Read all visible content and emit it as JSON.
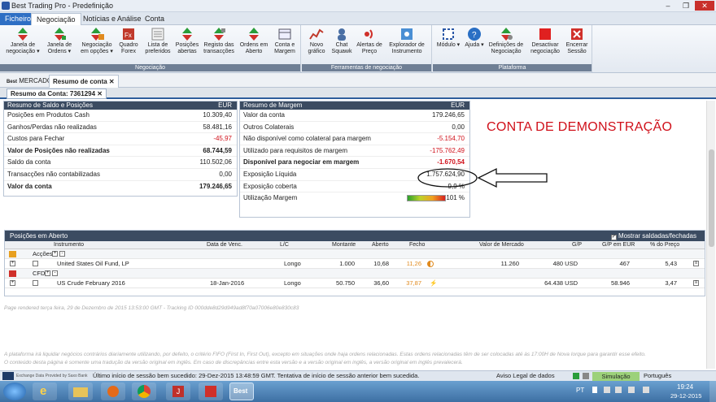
{
  "window": {
    "title": "Best Trading Pro - Predefinição",
    "minimize": "–",
    "restore": "❐",
    "close": "✕"
  },
  "menu": {
    "file": "Ficheiro",
    "tabs": [
      "Negociação",
      "Notícias e Análise",
      "Conta"
    ]
  },
  "ribbon": {
    "groups": [
      {
        "label": "Negociação",
        "buttons": [
          "Janela de negociação ▾",
          "Janela de Ordens ▾",
          "Negociação em opções ▾",
          "Quadro Forex",
          "Lista de preferidos",
          "Posições abertas",
          "Registo das transacções",
          "Ordens em Aberto",
          "Conta e Margem"
        ]
      },
      {
        "label": "Ferramentas de negociação",
        "buttons": [
          "Novo gráfico",
          "Chat Squawk",
          "Alertas de Preço",
          "Explorador de Instrumento"
        ]
      },
      {
        "label": "Plataforma",
        "buttons": [
          "Módulo ▾",
          "Ajuda ▾",
          "Definições de Negociação",
          "Desactivar negociação",
          "Encerrar Sessão"
        ]
      }
    ]
  },
  "doctabs": {
    "markets": "MERCADOS",
    "account_summary": "Resumo de conta",
    "close": "✕"
  },
  "subtab": {
    "label": "Resumo da Conta: 7361294",
    "close": "✕"
  },
  "balance": {
    "title": "Resumo de Saldo e Posições",
    "currency": "EUR",
    "rows": [
      {
        "label": "Posições em Produtos Cash",
        "value": "10.309,40"
      },
      {
        "label": "Ganhos/Perdas não realizadas",
        "value": "58.481,16"
      },
      {
        "label": "Custos para Fechar",
        "value": "-45,97"
      },
      {
        "label": "Valor de Posições não realizadas",
        "value": "68.744,59"
      },
      {
        "label": "Saldo da conta",
        "value": "110.502,06"
      },
      {
        "label": "Transacções não contabilizadas",
        "value": "0,00"
      },
      {
        "label": "Valor da conta",
        "value": "179.246,65"
      }
    ]
  },
  "margin": {
    "title": "Resumo de Margem",
    "currency": "EUR",
    "rows": [
      {
        "label": "Valor da conta",
        "value": "179.246,65"
      },
      {
        "label": "Outros Colaterais",
        "value": "0,00"
      },
      {
        "label": "Não disponível como colateral para margem",
        "value": "-5.154,70"
      },
      {
        "label": "Utilizado para requisitos de margem",
        "value": "-175.762,49"
      },
      {
        "label": "Disponível para negociar em margem",
        "value": "-1.670,54"
      },
      {
        "label": "Exposição Líquida",
        "value": "1.757.624,90"
      },
      {
        "label": "Exposição coberta",
        "value": "9,9 %"
      },
      {
        "label": "Utilização Margem",
        "value": "101 %"
      }
    ],
    "utilization": 1.01
  },
  "demo_label": "CONTA DE DEMONSTRAÇÃO",
  "positions": {
    "title": "Posições em Aberto",
    "show_closed": "Mostrar saldadas/fechadas",
    "columns": [
      "Instrumento",
      "Data de Venc.",
      "L/C",
      "Montante",
      "Aberto",
      "Fecho",
      "Valor de Mercado",
      "G/P",
      "G/P em EUR",
      "% do Preço"
    ],
    "groups": [
      {
        "name": "Acções",
        "rows": [
          {
            "instrument": "United States Oil Fund, LP",
            "expiry": "",
            "side": "Longo",
            "amount": "1.000",
            "open": "10,68",
            "close": "11,26",
            "market_value": "11.260",
            "pl": "480 USD",
            "pl_eur": "467",
            "pct": "5,43"
          }
        ]
      },
      {
        "name": "CFD",
        "rows": [
          {
            "instrument": "US Crude February 2016",
            "expiry": "18-Jan-2016",
            "side": "Longo",
            "amount": "50.750",
            "open": "36,60",
            "close": "37,87",
            "market_value": "",
            "pl": "64.438 USD",
            "pl_eur": "58.946",
            "pct": "3,47"
          }
        ]
      }
    ]
  },
  "footer": {
    "rendered": "Page rendered terça feira, 29 de Dezembro de 2015 13:53:00 GMT - Tracking ID 000dde8d29d949ad8f70a07006e80e830c83",
    "disclaimer1": "A plataforma irá liquidar negócios contrários diariamente utilizando, por defeito, o critério FIFO (First In, First Out), excepto em situações onde haja ordens relacionadas. Estas ordens relacionadas têm de ser colocadas até às 17:00H de Nova Iorque para garantir esse efeito.",
    "disclaimer2": "O conteúdo desta página é somente uma tradução da versão original em inglês. Em caso de discrepâncias entre esta versão e a versão original em inglês, a versão original em inglês prevalecerá."
  },
  "statusbar": {
    "provider": "Exchange Data Provided by Saxo Bank",
    "message": "Último início de sessão bem sucedido: 29-Dez-2015 13:48:59 GMT. Tentativa de início de sessão anterior bem sucedida.",
    "legal": "Aviso Legal de dados",
    "mode": "Simulação",
    "language": "Português"
  },
  "taskbar": {
    "lang": "PT",
    "time": "19:24",
    "date": "29-12-2015",
    "best": "Best"
  }
}
